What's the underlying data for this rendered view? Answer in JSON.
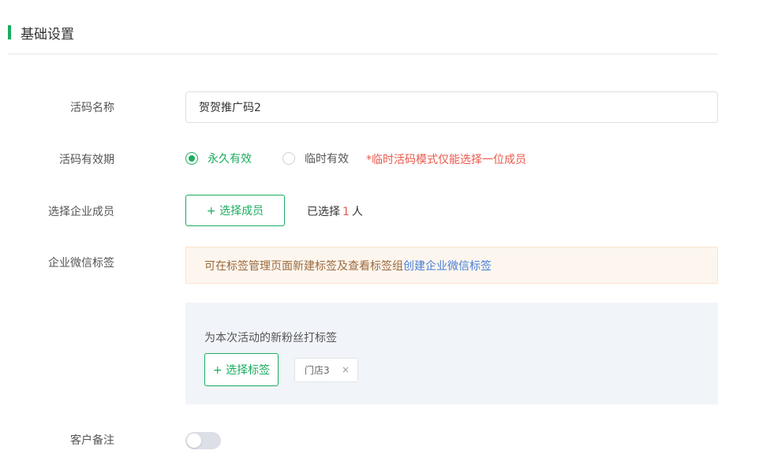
{
  "section": {
    "title": "基础设置"
  },
  "form": {
    "name": {
      "label": "活码名称",
      "value": "贺贺推广码2"
    },
    "validity": {
      "label": "活码有效期",
      "options": [
        {
          "label": "永久有效",
          "checked": true
        },
        {
          "label": "临时有效",
          "checked": false
        }
      ],
      "hint": "*临时活码模式仅能选择一位成员"
    },
    "members": {
      "label": "选择企业成员",
      "button_label": "+ 选择成员",
      "selected_prefix": "已选择",
      "selected_count": "1",
      "selected_suffix": "人"
    },
    "wechat_tags": {
      "label": "企业微信标签",
      "notice_text": "可在标签管理页面新建标签及查看标签组",
      "notice_link": "创建企业微信标签",
      "panel_title": "为本次活动的新粉丝打标签",
      "select_button": "+ 选择标签",
      "tags": [
        {
          "label": "门店3",
          "close_icon": "×"
        }
      ]
    },
    "remark": {
      "label": "客户备注",
      "enabled": false
    }
  },
  "colors": {
    "accent": "#1aad5f",
    "warning": "#e9584b",
    "link": "#4a7fd6",
    "notice_bg": "#fdf6ef",
    "panel_bg": "#f1f4f8"
  }
}
